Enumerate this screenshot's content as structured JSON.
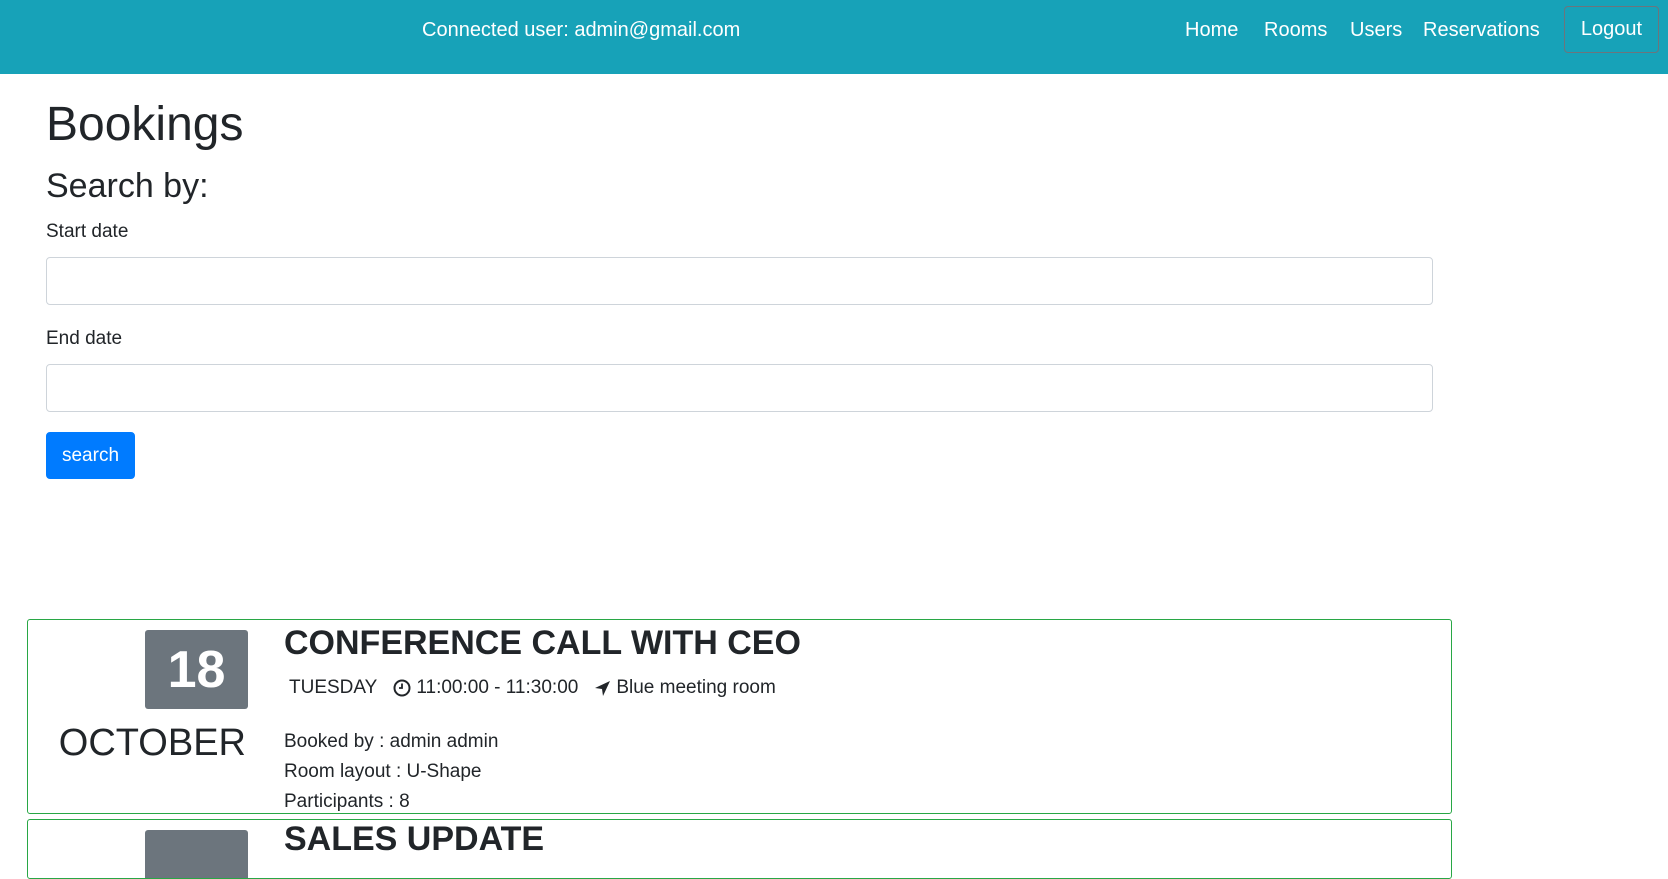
{
  "navbar": {
    "connected_user": "Connected user: admin@gmail.com",
    "links": [
      "Home",
      "Rooms",
      "Users",
      "Reservations"
    ],
    "logout": "Logout",
    "background": "#17a2b8"
  },
  "page": {
    "title": "Bookings",
    "search_heading": "Search by:"
  },
  "form": {
    "start_label": "Start date",
    "start_value": "",
    "end_label": "End date",
    "end_value": "",
    "search_button": "search"
  },
  "bookings": [
    {
      "day": "18",
      "month": "OCTOBER",
      "title": "CONFERENCE CALL WITH CEO",
      "weekday": "TUESDAY",
      "time": "11:00:00 - 11:30:00",
      "room": "Blue meeting room",
      "booked_by": "Booked by : admin admin",
      "layout": "Room layout : U-Shape",
      "participants": "Participants : 8"
    },
    {
      "title": "SALES UPDATE"
    }
  ],
  "icons": {
    "clock": "clock-icon",
    "location": "location-arrow-icon"
  },
  "colors": {
    "primary": "#007bff",
    "card_border": "#28a745",
    "date_badge": "#6c757d"
  }
}
